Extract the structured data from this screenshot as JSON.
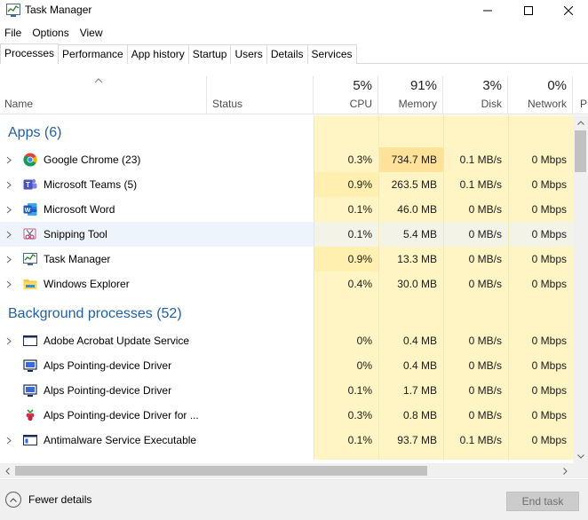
{
  "window": {
    "title": "Task Manager"
  },
  "menu": [
    "File",
    "Options",
    "View"
  ],
  "tabs": [
    "Processes",
    "Performance",
    "App history",
    "Startup",
    "Users",
    "Details",
    "Services"
  ],
  "columns": {
    "name": "Name",
    "status": "Status",
    "cpu": {
      "pct": "5%",
      "label": "CPU"
    },
    "memory": {
      "pct": "91%",
      "label": "Memory"
    },
    "disk": {
      "pct": "3%",
      "label": "Disk"
    },
    "network": {
      "pct": "0%",
      "label": "Network"
    },
    "power": "P"
  },
  "groups": {
    "apps": "Apps (6)",
    "background": "Background processes (52)"
  },
  "apps": [
    {
      "name": "Google Chrome (23)",
      "cpu": "0.3%",
      "memory": "734.7 MB",
      "disk": "0.1 MB/s",
      "network": "0 Mbps",
      "icon": "chrome-icon"
    },
    {
      "name": "Microsoft Teams (5)",
      "cpu": "0.9%",
      "memory": "263.5 MB",
      "disk": "0.1 MB/s",
      "network": "0 Mbps",
      "icon": "teams-icon"
    },
    {
      "name": "Microsoft Word",
      "cpu": "0.1%",
      "memory": "46.0 MB",
      "disk": "0 MB/s",
      "network": "0 Mbps",
      "icon": "word-icon"
    },
    {
      "name": "Snipping Tool",
      "cpu": "0.1%",
      "memory": "5.4 MB",
      "disk": "0 MB/s",
      "network": "0 Mbps",
      "icon": "snipping-tool-icon"
    },
    {
      "name": "Task Manager",
      "cpu": "0.9%",
      "memory": "13.3 MB",
      "disk": "0 MB/s",
      "network": "0 Mbps",
      "icon": "task-manager-icon"
    },
    {
      "name": "Windows Explorer",
      "cpu": "0.4%",
      "memory": "30.0 MB",
      "disk": "0 MB/s",
      "network": "0 Mbps",
      "icon": "folder-icon"
    }
  ],
  "background": [
    {
      "name": "Adobe Acrobat Update Service",
      "cpu": "0%",
      "memory": "0.4 MB",
      "disk": "0 MB/s",
      "network": "0 Mbps",
      "icon": "service-window-icon"
    },
    {
      "name": "Alps Pointing-device Driver",
      "cpu": "0%",
      "memory": "0.4 MB",
      "disk": "0 MB/s",
      "network": "0 Mbps",
      "icon": "monitor-icon"
    },
    {
      "name": "Alps Pointing-device Driver",
      "cpu": "0.1%",
      "memory": "1.7 MB",
      "disk": "0 MB/s",
      "network": "0 Mbps",
      "icon": "monitor-icon"
    },
    {
      "name": "Alps Pointing-device Driver for ...",
      "cpu": "0.3%",
      "memory": "0.8 MB",
      "disk": "0 MB/s",
      "network": "0 Mbps",
      "icon": "raspberry-icon"
    },
    {
      "name": "Antimalware Service Executable",
      "cpu": "0.1%",
      "memory": "93.7 MB",
      "disk": "0.1 MB/s",
      "network": "0 Mbps",
      "icon": "service-window-icon"
    }
  ],
  "footer": {
    "fewer_details": "Fewer details",
    "end_task": "End task"
  }
}
